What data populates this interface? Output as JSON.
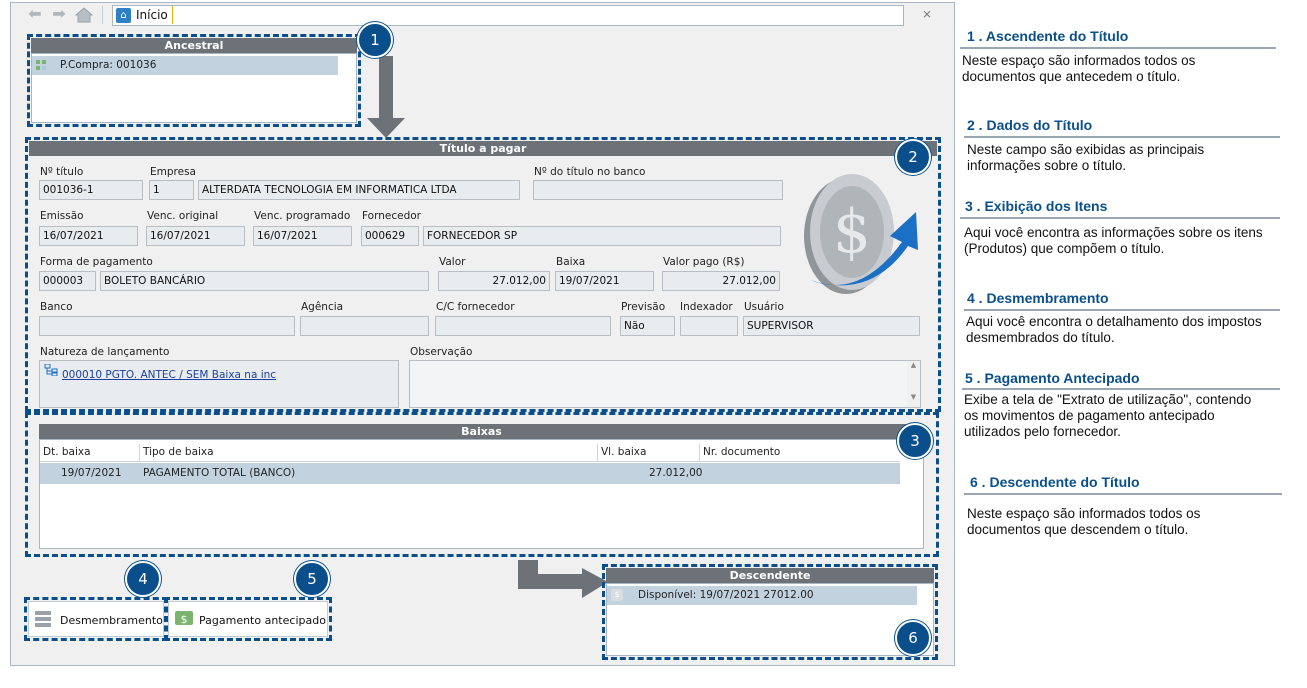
{
  "topbar": {
    "tab_title": "Início",
    "close_glyph": "⨯"
  },
  "ancestral": {
    "title": "Ancestral",
    "item": "P.Compra: 001036"
  },
  "titulo": {
    "title": "Título a pagar",
    "labels": {
      "num_titulo": "Nº título",
      "empresa": "Empresa",
      "num_banco": "Nº do título no banco",
      "emissao": "Emissão",
      "venc_original": "Venc. original",
      "venc_programado": "Venc. programado",
      "fornecedor": "Fornecedor",
      "forma_pagamento": "Forma de pagamento",
      "valor": "Valor",
      "baixa": "Baixa",
      "valor_pago": "Valor pago (R$)",
      "banco": "Banco",
      "agencia": "Agência",
      "cc_fornecedor": "C/C fornecedor",
      "previsao": "Previsão",
      "indexador": "Indexador",
      "usuario": "Usuário",
      "natureza": "Natureza de lançamento",
      "observacao": "Observação"
    },
    "values": {
      "num_titulo": "001036-1",
      "empresa_cod": "1",
      "empresa_nome": "ALTERDATA TECNOLOGIA EM INFORMATICA LTDA",
      "num_banco": "",
      "emissao": "16/07/2021",
      "venc_original": "16/07/2021",
      "venc_programado": "16/07/2021",
      "fornecedor_cod": "000629",
      "fornecedor_nome": "FORNECEDOR SP",
      "forma_cod": "000003",
      "forma_nome": "BOLETO BANCÁRIO",
      "valor": "27.012,00",
      "baixa": "19/07/2021",
      "valor_pago": "27.012,00",
      "banco": "",
      "agencia": "",
      "cc_fornecedor": "",
      "previsao": "Não",
      "indexador": "",
      "usuario": "SUPERVISOR",
      "natureza": "000010  PGTO. ANTEC / SEM Baixa na inc",
      "observacao": ""
    }
  },
  "baixas": {
    "title": "Baixas",
    "columns": [
      "Dt. baixa",
      "Tipo de baixa",
      "Vl. baixa",
      "Nr. documento"
    ],
    "rows": [
      {
        "dt": "19/07/2021",
        "tipo": "PAGAMENTO TOTAL (BANCO)",
        "vl": "27.012,00",
        "nr": ""
      }
    ]
  },
  "buttons": {
    "desmembramento": "Desmembramento",
    "pagamento": "Pagamento antecipado"
  },
  "descendente": {
    "title": "Descendente",
    "item": "Disponível: 19/07/2021  27012.00"
  },
  "badges": [
    "1",
    "2",
    "3",
    "4",
    "5",
    "6"
  ],
  "icons": [
    "back-arrow-icon",
    "forward-arrow-icon",
    "home-icon",
    "money-icon",
    "tree-icon",
    "list-icon",
    "dollar-icon"
  ],
  "colors": {
    "accent": "#0a4f8c",
    "header": "#6d7278",
    "selected_row": "#c2d3df"
  },
  "annotations": [
    {
      "title": "1 . Ascendente do Título",
      "desc": "Neste espaço são informados todos os documentos que antecedem o título."
    },
    {
      "title": "2 . Dados do Título",
      "desc": "Neste campo são exibidas as principais informações sobre o título."
    },
    {
      "title": "3 . Exibição dos Itens",
      "desc": "Aqui você encontra as informações sobre os itens (Produtos) que compõem o título."
    },
    {
      "title": "4 . Desmembramento",
      "desc": "Aqui você encontra o detalhamento dos impostos desmembrados do título."
    },
    {
      "title": "5 . Pagamento Antecipado",
      "desc": "Exibe a tela de \"Extrato de utilização\", contendo os movimentos de pagamento antecipado utilizados pelo fornecedor."
    },
    {
      "title": "6 . Descendente do Título",
      "desc": "Neste espaço são informados todos os documentos que descendem o título."
    }
  ]
}
